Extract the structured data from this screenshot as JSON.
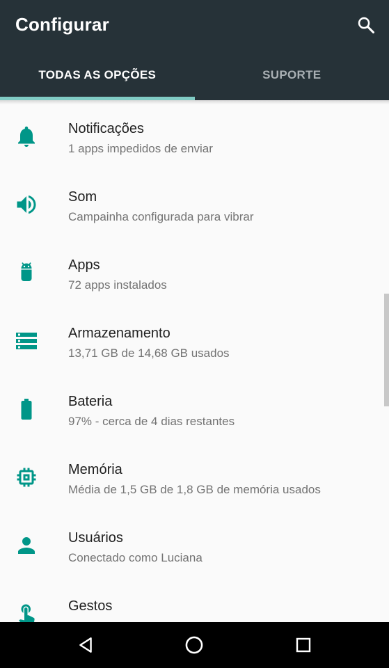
{
  "app_bar": {
    "title": "Configurar",
    "search_icon": "search-icon"
  },
  "tabs": [
    {
      "label": "TODAS AS OPÇÕES",
      "selected": true
    },
    {
      "label": "SUPORTE",
      "selected": false
    }
  ],
  "colors": {
    "appbar": "#263238",
    "accent": "#009688",
    "tab_indicator": "#80cbc4",
    "background": "#fafafa"
  },
  "items": [
    {
      "icon": "bell-icon",
      "label": "Notificações",
      "summary": "1 apps impedidos de enviar"
    },
    {
      "icon": "volume-icon",
      "label": "Som",
      "summary": "Campainha configurada para vibrar"
    },
    {
      "icon": "android-icon",
      "label": "Apps",
      "summary": "72 apps instalados"
    },
    {
      "icon": "storage-icon",
      "label": "Armazenamento",
      "summary": "13,71 GB de 14,68 GB usados"
    },
    {
      "icon": "battery-icon",
      "label": "Bateria",
      "summary": "97% - cerca de 4 dias restantes"
    },
    {
      "icon": "memory-icon",
      "label": "Memória",
      "summary": "Média de 1,5 GB de 1,8 GB de memória usados"
    },
    {
      "icon": "person-icon",
      "label": "Usuários",
      "summary": "Conectado como Luciana"
    },
    {
      "icon": "gesture-icon",
      "label": "Gestos",
      "summary": ""
    }
  ],
  "nav_bar": {
    "back": "back-icon",
    "home": "home-icon",
    "recents": "recents-icon"
  }
}
